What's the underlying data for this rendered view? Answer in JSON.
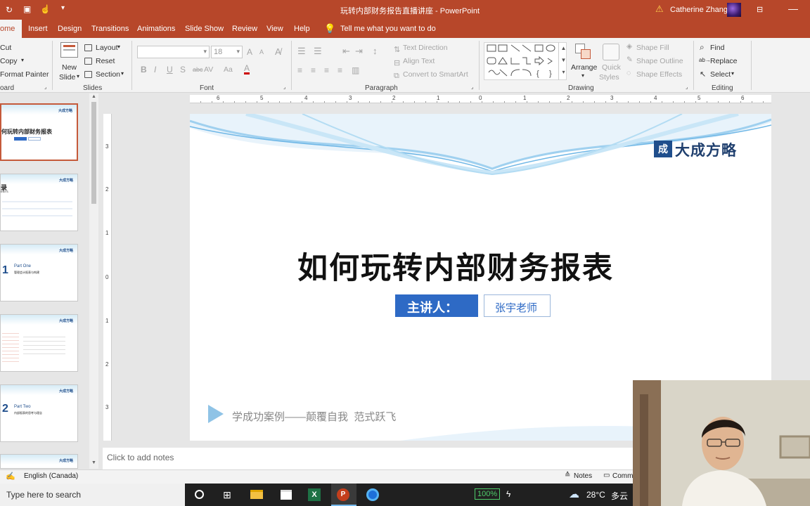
{
  "window": {
    "title": "玩转内部财务报告直播讲座 - PowerPoint",
    "user_name": "Catherine Zhang",
    "warning_glyph": "⚠"
  },
  "ribbon_tabs": [
    "ome",
    "Insert",
    "Design",
    "Transitions",
    "Animations",
    "Slide Show",
    "Review",
    "View",
    "Help"
  ],
  "tell_me": "Tell me what you want to do",
  "clipboard": {
    "cut": "Cut",
    "copy": "Copy",
    "format_painter": "Format Painter",
    "group": "oard"
  },
  "slides_group": {
    "new_slide_1": "New",
    "new_slide_2": "Slide",
    "layout": "Layout",
    "reset": "Reset",
    "section": "Section",
    "group": "Slides"
  },
  "font_group": {
    "size": "18",
    "group": "Font",
    "bold": "B",
    "italic": "I",
    "underline": "U",
    "shadow": "S",
    "strike": "abc",
    "case": "Aa",
    "spacing": "AV",
    "grow": "A",
    "shrink": "A"
  },
  "paragraph_group": {
    "text_direction": "Text Direction",
    "align_text": "Align Text",
    "convert_smartart": "Convert to SmartArt",
    "group": "Paragraph"
  },
  "drawing_group": {
    "arrange": "Arrange",
    "quick_styles_1": "Quick",
    "quick_styles_2": "Styles",
    "shape_fill": "Shape Fill",
    "shape_outline": "Shape Outline",
    "shape_effects": "Shape Effects",
    "group": "Drawing"
  },
  "editing_group": {
    "find": "Find",
    "replace": "Replace",
    "select": "Select",
    "group": "Editing"
  },
  "ruler": {
    "top": [
      "6",
      "5",
      "4",
      "3",
      "2",
      "1",
      "0",
      "1",
      "2",
      "3",
      "4",
      "5",
      "6"
    ],
    "left": [
      "3",
      "2",
      "1",
      "0",
      "1",
      "2",
      "3"
    ]
  },
  "thumbnails": [
    {
      "title": "何玩转内部财务报表",
      "sub": "",
      "logo": "大成方略"
    },
    {
      "title": "录",
      "sub": "ENTS",
      "logo": "大成方略"
    },
    {
      "title": "Part One",
      "sub": "管理会计报表与构建",
      "logo": "大成方略",
      "num": "1"
    },
    {
      "title": "",
      "sub": "",
      "logo": "大成方略"
    },
    {
      "title": "Part Two",
      "sub": "内部报表的思考与理念",
      "logo": "大成方略",
      "num": "2"
    },
    {
      "title": "",
      "sub": "",
      "logo": "大成方略"
    }
  ],
  "slide": {
    "logo_text": "大成方略",
    "title": "如何玩转内部财务报表",
    "presenter_label": "主讲人：",
    "presenter_name": "张宇老师",
    "slogan": "学成功案例——颠覆自我  范式跃飞"
  },
  "notes_placeholder": "Click to add notes",
  "status": {
    "language": "English (Canada)",
    "notes": "Notes",
    "comments": "Comme"
  },
  "taskbar": {
    "search": "Type here to search",
    "battery": "100%",
    "temperature": "28°C",
    "weather": "多云"
  },
  "colors": {
    "accent": "#b7472a",
    "presenter_box": "#2e6ac5",
    "title_text": "#111111"
  }
}
